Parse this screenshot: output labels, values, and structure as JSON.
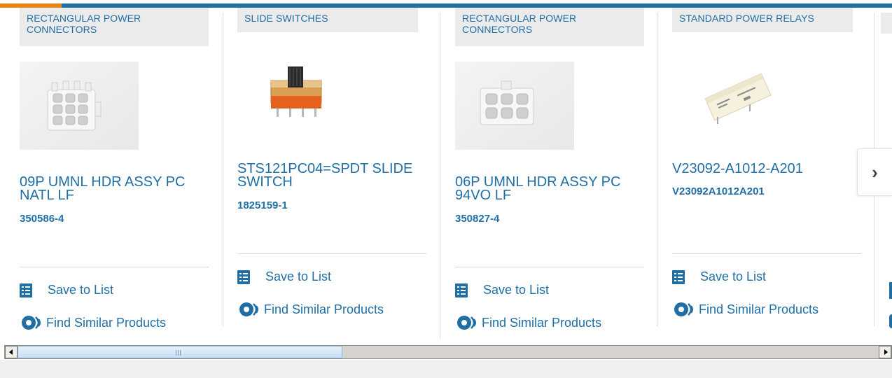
{
  "products": [
    {
      "category": "RECTANGULAR POWER CONNECTORS",
      "title": "09P UMNL HDR ASSY PC NATL LF",
      "part_number": "350586-4",
      "save_label": "Save to List",
      "similar_label": "Find Similar Products"
    },
    {
      "category": "SLIDE SWITCHES",
      "title": "STS121PC04=SPDT SLIDE SWITCH",
      "part_number": "1825159-1",
      "save_label": "Save to List",
      "similar_label": "Find Similar Products"
    },
    {
      "category": "RECTANGULAR POWER CONNECTORS",
      "title": "06P UMNL HDR ASSY PC 94VO LF",
      "part_number": "350827-4",
      "save_label": "Save to List",
      "similar_label": "Find Similar Products"
    },
    {
      "category": "STANDARD POWER RELAYS",
      "title": "V23092-A1012-A201",
      "part_number": "V23092A1012A201",
      "save_label": "Save to List",
      "similar_label": "Find Similar Products"
    }
  ],
  "carousel": {
    "next_icon": "chevron-right-icon",
    "next_glyph": "›"
  },
  "scrollbar": {
    "position_fraction": 0.0
  },
  "colors": {
    "accent": "#1f6fa5",
    "orange": "#e8840f",
    "category_bg": "#ebebeb"
  }
}
